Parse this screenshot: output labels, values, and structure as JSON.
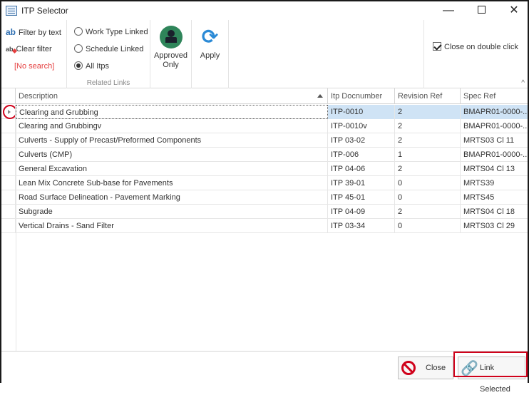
{
  "window": {
    "title": "ITP Selector",
    "minimize_glyph": "—",
    "close_glyph": "✕"
  },
  "ribbon": {
    "filter": {
      "filter_by_text": "Filter by text",
      "filter_by_text_icon": "ab",
      "clear_filter": "Clear filter",
      "clear_filter_icon": "ab",
      "no_search": "[No search]"
    },
    "related_links": {
      "caption": "Related Links",
      "options": [
        {
          "label": "Work Type Linked",
          "checked": false
        },
        {
          "label": "Schedule Linked",
          "checked": false
        },
        {
          "label": "All Itps",
          "checked": true
        }
      ]
    },
    "approved_only": {
      "label_line1": "Approved",
      "label_line2": "Only",
      "icon": "stamp-icon"
    },
    "apply": {
      "label": "Apply",
      "icon": "refresh-icon",
      "glyph": "⟳"
    },
    "close_on_double_click": {
      "label": "Close on double click",
      "checked": true
    },
    "collapse_glyph": "^"
  },
  "grid": {
    "columns": {
      "description": "Description",
      "itp_docnumber": "Itp Docnumber",
      "revision_ref": "Revision Ref",
      "spec_ref": "Spec Ref"
    },
    "sort": {
      "column": "description",
      "direction": "ascending"
    },
    "rows": [
      {
        "description": "Clearing and Grubbing",
        "itp": "ITP-0010",
        "rev": "2",
        "spec": "BMAPR01-0000-...",
        "selected": true
      },
      {
        "description": "Clearing and Grubbingv",
        "itp": "ITP-0010v",
        "rev": "2",
        "spec": "BMAPR01-0000-..."
      },
      {
        "description": "Culverts - Supply of Precast/Preformed Components",
        "itp": "ITP 03-02",
        "rev": "2",
        "spec": "MRTS03 Cl 11"
      },
      {
        "description": "Culverts (CMP)",
        "itp": "ITP-006",
        "rev": "1",
        "spec": "BMAPR01-0000-..."
      },
      {
        "description": "General Excavation",
        "itp": "ITP 04-06",
        "rev": "2",
        "spec": "MRTS04 Cl 13"
      },
      {
        "description": "Lean Mix Concrete Sub-base for Pavements",
        "itp": "ITP 39-01",
        "rev": "0",
        "spec": "MRTS39"
      },
      {
        "description": "Road Surface Delineation - Pavement Marking",
        "itp": "ITP 45-01",
        "rev": "0",
        "spec": "MRTS45"
      },
      {
        "description": "Subgrade",
        "itp": "ITP 04-09",
        "rev": "2",
        "spec": "MRTS04 Cl 18"
      },
      {
        "description": "Vertical Drains - Sand Filter",
        "itp": "ITP 03-34",
        "rev": "0",
        "spec": "MRTS03 Cl 29"
      }
    ]
  },
  "footer": {
    "close": {
      "label": "Close",
      "icon": "prohibited-icon"
    },
    "link_selected": {
      "label": "Link Selected",
      "icon": "link-icon",
      "glyph": "🔗"
    }
  },
  "colors": {
    "accent_blue": "#2b6cb0",
    "highlight_red": "#d0021b",
    "selection_blue": "#cfe3f5",
    "approved_green": "#2f855a"
  }
}
